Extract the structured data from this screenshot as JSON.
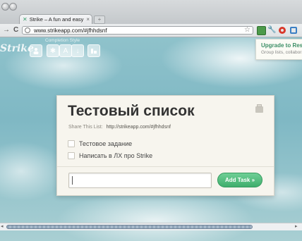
{
  "browser": {
    "tab": {
      "favicon": "✕",
      "title": "Strike – A fun and easy way t",
      "close": "×"
    },
    "new_tab": "+",
    "nav": {
      "forward": "→",
      "reload": "C"
    },
    "address": "www.strikeapp.com/#jfhhdsnf",
    "bookmark_icon": "star-icon",
    "extensions": [
      "green-extension-icon",
      "wrench-icon",
      "red-circle-icon",
      "blue-square-icon"
    ]
  },
  "app": {
    "logo": "Strike",
    "completion_style_label": "Completion Style",
    "toolbar_icons": [
      "person-icon",
      "sparkle-icon",
      "letter-a-icon",
      "arrow-down-icon",
      "sort-icon"
    ],
    "upgrade": {
      "title": "Upgrade to Reso",
      "subtitle": "Group lists, collaborat"
    }
  },
  "list": {
    "title": "Тестовый список",
    "share_label": "Share This List:",
    "share_url": "http://strikeapp.com/#jfhhdsnf",
    "tasks": [
      {
        "label": "Тестовое задание",
        "checked": false
      },
      {
        "label": "Написать в ЛХ про Strike",
        "checked": false
      }
    ],
    "new_task_value": "",
    "add_button": "Add Task »"
  },
  "scrollbar": {
    "left_arrow": "◂",
    "right_arrow": "▸"
  }
}
